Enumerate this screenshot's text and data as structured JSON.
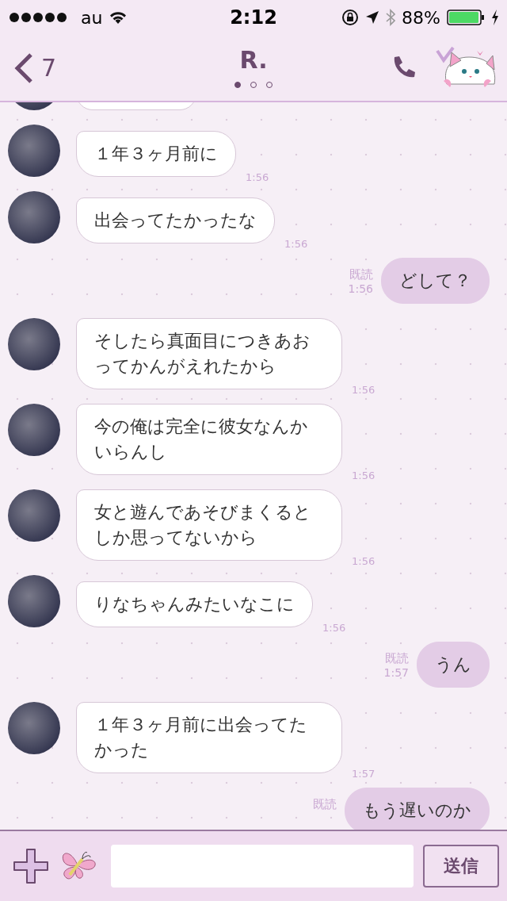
{
  "status_bar": {
    "carrier": "au",
    "time": "2:12",
    "battery": "88%"
  },
  "header": {
    "back_count": "7",
    "title": "R.",
    "pages": [
      {
        "selected": true
      },
      {
        "selected": false
      },
      {
        "selected": false
      }
    ]
  },
  "messages": [
    {
      "kind": "in",
      "text": "１年３ヶ月前に",
      "time": "1:56"
    },
    {
      "kind": "in",
      "text": "出会ってたかったな",
      "time": "1:56"
    },
    {
      "kind": "out",
      "text": "どして？",
      "read": "既読",
      "time": "1:56"
    },
    {
      "kind": "in",
      "text": "そしたら真面目につきあおってかんがえれたから",
      "time": "1:56"
    },
    {
      "kind": "in",
      "text": "今の俺は完全に彼女なんかいらんし",
      "time": "1:56"
    },
    {
      "kind": "in",
      "text": "女と遊んであそびまくるとしか思ってないから",
      "time": "1:56"
    },
    {
      "kind": "in",
      "text": "りなちゃんみたいなこに",
      "time": "1:56"
    },
    {
      "kind": "out",
      "text": "うん",
      "read": "既読",
      "time": "1:57"
    },
    {
      "kind": "in",
      "text": "１年３ヶ月前に出会ってたかった",
      "time": "1:57"
    },
    {
      "kind": "out",
      "text": "もう遅いのか",
      "read": "既読"
    }
  ],
  "composer": {
    "send_button": "送信"
  }
}
